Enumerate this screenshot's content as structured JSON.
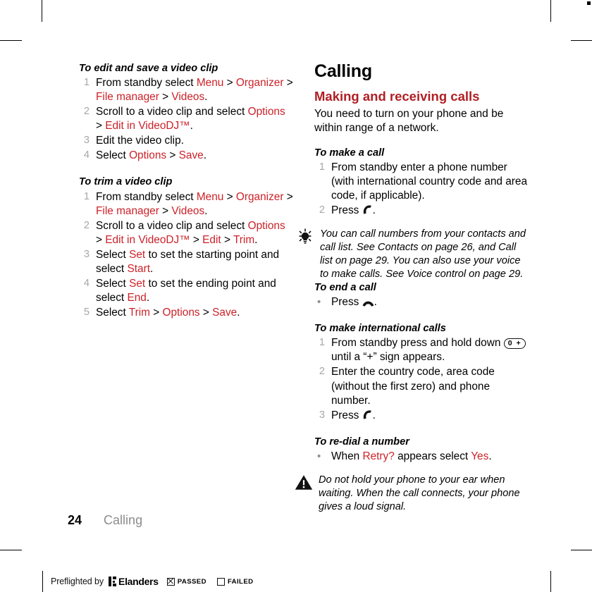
{
  "document": {
    "footer": {
      "page_number": "24",
      "chapter": "Calling"
    }
  },
  "left_column": {
    "procedures": [
      {
        "title": "To edit and save a video clip",
        "list_type": "ordered",
        "steps": [
          [
            {
              "t": "From standby select ",
              "c": "black"
            },
            {
              "t": "Menu",
              "c": "red"
            },
            {
              "t": " > ",
              "c": "black"
            },
            {
              "t": "Organizer",
              "c": "red"
            },
            {
              "t": " > ",
              "c": "black"
            },
            {
              "t": "File manager",
              "c": "red"
            },
            {
              "t": " > ",
              "c": "black"
            },
            {
              "t": "Videos",
              "c": "red"
            },
            {
              "t": ".",
              "c": "black"
            }
          ],
          [
            {
              "t": "Scroll to a video clip and select ",
              "c": "black"
            },
            {
              "t": "Options",
              "c": "red"
            },
            {
              "t": " > ",
              "c": "black"
            },
            {
              "t": "Edit in VideoDJ™",
              "c": "red"
            },
            {
              "t": ".",
              "c": "black"
            }
          ],
          [
            {
              "t": "Edit the video clip.",
              "c": "black"
            }
          ],
          [
            {
              "t": "Select ",
              "c": "black"
            },
            {
              "t": "Options",
              "c": "red"
            },
            {
              "t": " > ",
              "c": "black"
            },
            {
              "t": "Save",
              "c": "red"
            },
            {
              "t": ".",
              "c": "black"
            }
          ]
        ]
      },
      {
        "title": "To trim a video clip",
        "list_type": "ordered",
        "steps": [
          [
            {
              "t": "From standby select ",
              "c": "black"
            },
            {
              "t": "Menu",
              "c": "red"
            },
            {
              "t": " > ",
              "c": "black"
            },
            {
              "t": "Organizer",
              "c": "red"
            },
            {
              "t": " > ",
              "c": "black"
            },
            {
              "t": "File manager",
              "c": "red"
            },
            {
              "t": " > ",
              "c": "black"
            },
            {
              "t": "Videos",
              "c": "red"
            },
            {
              "t": ".",
              "c": "black"
            }
          ],
          [
            {
              "t": "Scroll to a video clip and select ",
              "c": "black"
            },
            {
              "t": "Options",
              "c": "red"
            },
            {
              "t": " > ",
              "c": "black"
            },
            {
              "t": "Edit in VideoDJ™",
              "c": "red"
            },
            {
              "t": " > ",
              "c": "black"
            },
            {
              "t": "Edit",
              "c": "red"
            },
            {
              "t": " > ",
              "c": "black"
            },
            {
              "t": "Trim",
              "c": "red"
            },
            {
              "t": ".",
              "c": "black"
            }
          ],
          [
            {
              "t": "Select ",
              "c": "black"
            },
            {
              "t": "Set",
              "c": "red"
            },
            {
              "t": " to set the starting point and select ",
              "c": "black"
            },
            {
              "t": "Start",
              "c": "red"
            },
            {
              "t": ".",
              "c": "black"
            }
          ],
          [
            {
              "t": "Select ",
              "c": "black"
            },
            {
              "t": "Set",
              "c": "red"
            },
            {
              "t": " to set the ending point and select ",
              "c": "black"
            },
            {
              "t": "End",
              "c": "red"
            },
            {
              "t": ".",
              "c": "black"
            }
          ],
          [
            {
              "t": "Select ",
              "c": "black"
            },
            {
              "t": "Trim",
              "c": "red"
            },
            {
              "t": " > ",
              "c": "black"
            },
            {
              "t": "Options",
              "c": "red"
            },
            {
              "t": " > ",
              "c": "black"
            },
            {
              "t": "Save",
              "c": "red"
            },
            {
              "t": ".",
              "c": "black"
            }
          ]
        ]
      }
    ]
  },
  "right_column": {
    "chapter_title": "Calling",
    "section_heading": "Making and receiving calls",
    "section_intro": "You need to turn on your phone and be within range of a network.",
    "blocks": [
      {
        "kind": "procedure",
        "title": "To make a call",
        "list_type": "ordered",
        "steps": [
          [
            {
              "t": "From standby enter a phone number (with international country code and area code, if applicable).",
              "c": "black"
            }
          ],
          [
            {
              "t": "Press ",
              "c": "black"
            },
            {
              "t": "",
              "c": "icon",
              "icon": "call-key-icon"
            },
            {
              "t": ".",
              "c": "black"
            }
          ]
        ]
      },
      {
        "kind": "note",
        "style": "tip",
        "icon": "lightbulb-icon",
        "text": "You can call numbers from your contacts and call list. See Contacts on page 26, and Call list on page 29. You can also use your voice to make calls. See Voice control on page 29."
      },
      {
        "kind": "procedure",
        "title": "To end a call",
        "list_type": "bulleted",
        "steps": [
          [
            {
              "t": "Press ",
              "c": "black"
            },
            {
              "t": "",
              "c": "icon",
              "icon": "end-call-key-icon"
            },
            {
              "t": ".",
              "c": "black"
            }
          ]
        ]
      },
      {
        "kind": "procedure",
        "title": "To make international calls",
        "list_type": "ordered",
        "steps": [
          [
            {
              "t": "From standby press and hold down ",
              "c": "black"
            },
            {
              "t": "0 +",
              "c": "key"
            },
            {
              "t": " until a “+” sign appears.",
              "c": "black"
            }
          ],
          [
            {
              "t": "Enter the country code, area code (without the first zero) and phone number.",
              "c": "black"
            }
          ],
          [
            {
              "t": "Press ",
              "c": "black"
            },
            {
              "t": "",
              "c": "icon",
              "icon": "call-key-icon"
            },
            {
              "t": ".",
              "c": "black"
            }
          ]
        ]
      },
      {
        "kind": "procedure",
        "title": "To re-dial a number",
        "list_type": "bulleted",
        "steps": [
          [
            {
              "t": "When ",
              "c": "black"
            },
            {
              "t": "Retry?",
              "c": "red"
            },
            {
              "t": " appears select ",
              "c": "black"
            },
            {
              "t": "Yes",
              "c": "red"
            },
            {
              "t": ".",
              "c": "black"
            }
          ]
        ]
      },
      {
        "kind": "note",
        "style": "warning",
        "icon": "warning-triangle-icon",
        "text": "Do not hold your phone to your ear when waiting. When the call connects, your phone gives a loud signal."
      }
    ]
  },
  "preflight_bar": {
    "prefix": "Preflighted by",
    "brand": "Elanders",
    "passed_label": "PASSED",
    "failed_label": "FAILED",
    "passed_checked": true,
    "failed_checked": false
  },
  "colors": {
    "accent_red": "#cc2229",
    "heading_red": "#b01f24",
    "step_number_gray": "#a7a7a7",
    "footer_gray": "#8c8c8c"
  }
}
